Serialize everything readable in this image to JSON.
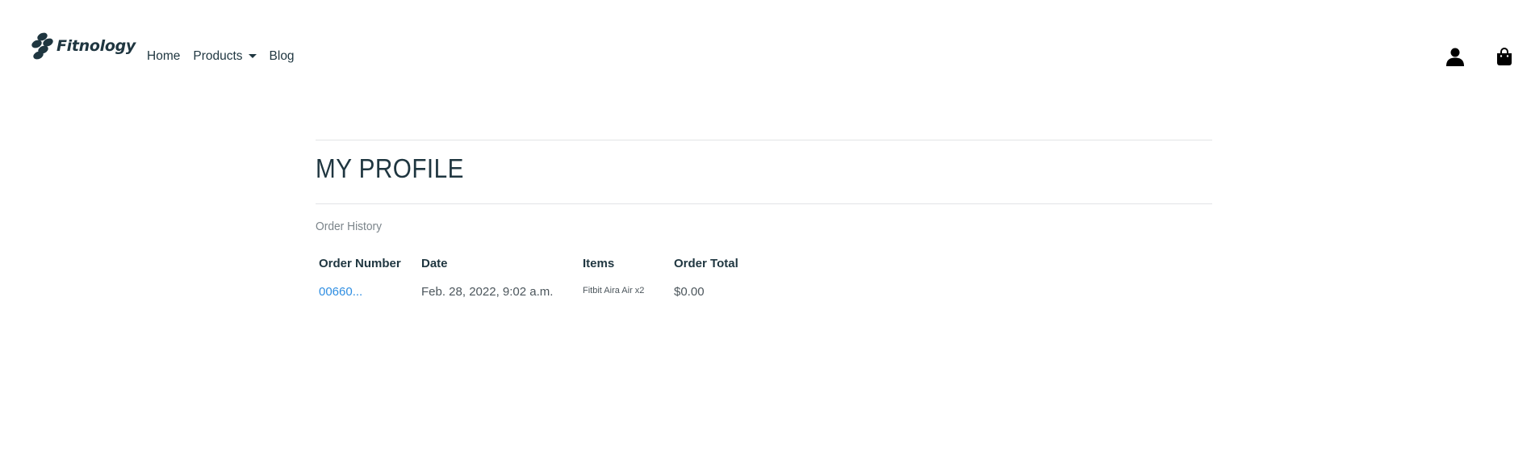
{
  "brand": {
    "name": "Fitnology",
    "color": "#1f3640"
  },
  "nav": {
    "home": "Home",
    "products": "Products",
    "blog": "Blog"
  },
  "header_icons": {
    "account": "user-icon",
    "bag": "shopping-bag-icon"
  },
  "main": {
    "title": "MY PROFILE",
    "section_label": "Order History",
    "table": {
      "headers": [
        "Order Number",
        "Date",
        "Items",
        "Order Total"
      ],
      "rows": [
        {
          "order_number": "00660...",
          "date": "Feb. 28, 2022, 9:02 a.m.",
          "items": "Fitbit Aira Air x2",
          "total": "$0.00"
        }
      ]
    }
  },
  "colors": {
    "text": "#1f3640",
    "muted": "#7b848a",
    "link": "#2f8ee2",
    "rule": "#e2e4e6"
  }
}
